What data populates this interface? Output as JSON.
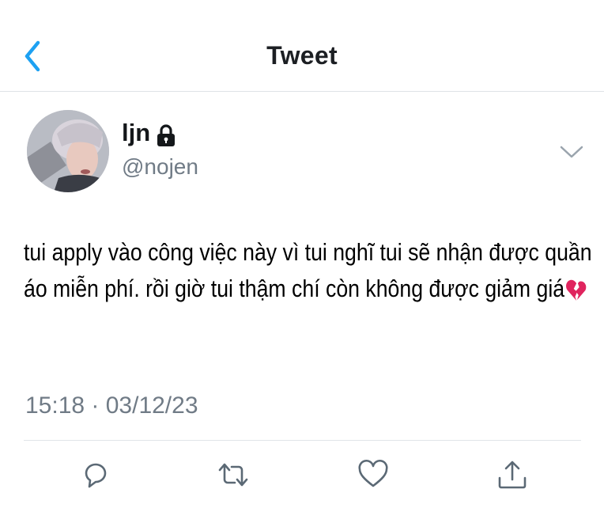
{
  "header": {
    "title": "Tweet",
    "back_icon": "chevron-left-icon",
    "accent_color": "#1da1f2"
  },
  "user": {
    "display_name": "ljn",
    "handle": "@nojen",
    "protected_icon": "lock-icon",
    "menu_icon": "chevron-down-icon"
  },
  "tweet": {
    "text": "tui apply vào công việc này vì tui nghĩ tui sẽ nhận được quần áo miễn phí. rồi giờ tui thậm chí còn không được giảm giá",
    "emoji": "💔",
    "timestamp": "15:18 · 03/12/23"
  },
  "actions": [
    "reply-icon",
    "retweet-icon",
    "like-icon",
    "share-icon"
  ]
}
